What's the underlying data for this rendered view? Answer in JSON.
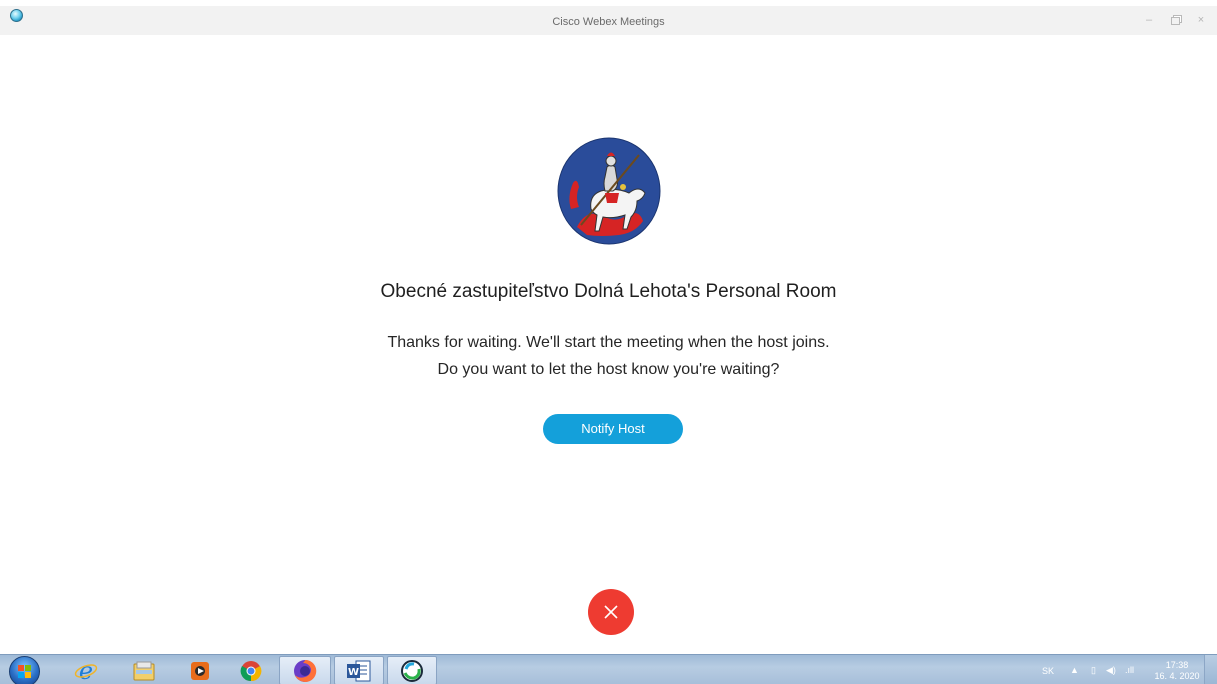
{
  "window": {
    "title": "Cisco Webex Meetings",
    "app_icon": "webex-icon",
    "controls": {
      "minimize": "–",
      "restore": "",
      "close": "×"
    }
  },
  "meeting": {
    "logo": "coat-of-arms-logo",
    "room_title": "Obecné zastupiteľstvo Dolná Lehota's Personal Room",
    "message_line1": "Thanks for waiting. We'll start the meeting when the host joins.",
    "message_line2": "Do you want to let the host know you're waiting?",
    "notify_button": "Notify Host",
    "leave_icon": "close-icon",
    "colors": {
      "accent": "#14a0da",
      "leave": "#ee3b31"
    }
  },
  "taskbar": {
    "start_icon": "windows-start-icon",
    "items": [
      {
        "icon": "internet-explorer-icon"
      },
      {
        "icon": "file-explorer-icon"
      },
      {
        "icon": "media-player-icon"
      },
      {
        "icon": "chrome-icon"
      },
      {
        "icon": "firefox-icon",
        "active": true
      },
      {
        "icon": "word-icon",
        "active": true
      },
      {
        "icon": "webex-icon",
        "active": true
      }
    ],
    "tray": {
      "language": "SK",
      "time": "17:38",
      "date": "16. 4. 2020"
    }
  }
}
